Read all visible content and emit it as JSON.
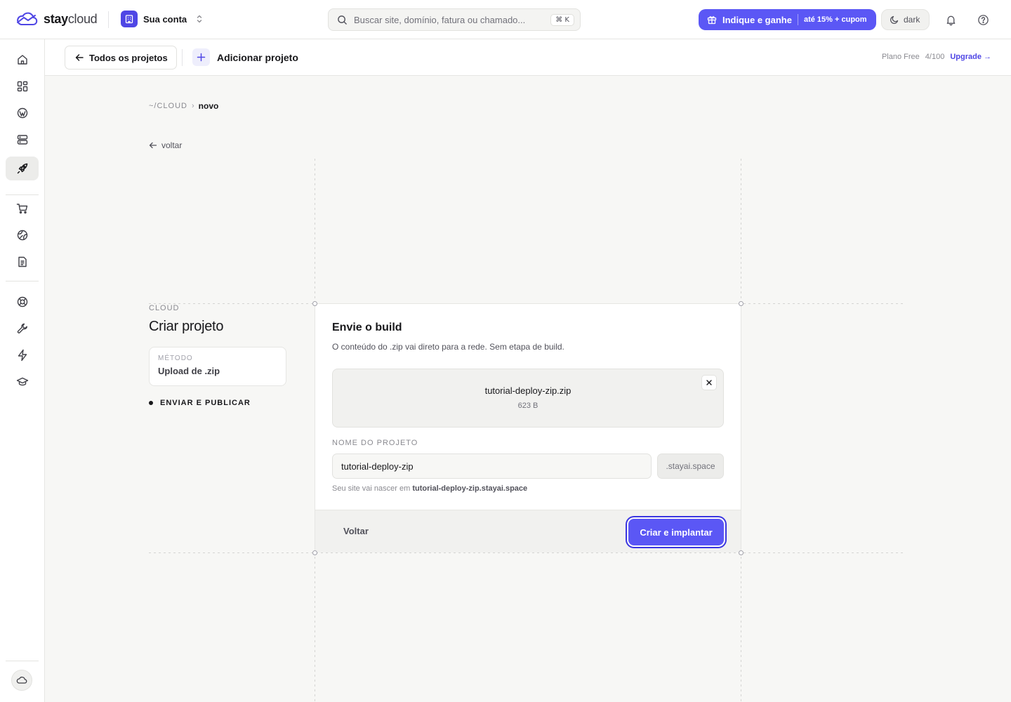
{
  "brand": {
    "name_bold": "stay",
    "name_light": "cloud"
  },
  "account": {
    "name": "Sua conta"
  },
  "search": {
    "placeholder": "Buscar site, domínio, fatura ou chamado...",
    "shortcut": "⌘ K"
  },
  "promo": {
    "label": "Indique e ganhe",
    "badge": "até 15% + cupom"
  },
  "theme": {
    "label": "dark"
  },
  "colors": {
    "accent": "#5b57f5",
    "accent_dark": "#4f46e5",
    "background": "#f7f7f5"
  },
  "icons": {
    "logo": "cloud-icon",
    "account": "building-icon",
    "switch": "chevron-updown-icon",
    "search": "search-icon",
    "promo": "gift-icon",
    "theme": "moon-icon",
    "notifications": "bell-icon",
    "help": "help-circle-icon"
  },
  "sidebar": {
    "items": [
      {
        "icon": "home-icon"
      },
      {
        "icon": "grid-icon"
      },
      {
        "icon": "wordpress-icon"
      },
      {
        "icon": "server-icon"
      },
      {
        "icon": "rocket-icon",
        "active": true
      },
      {
        "icon": "cart-icon"
      },
      {
        "icon": "globe-icon"
      },
      {
        "icon": "document-icon"
      },
      {
        "icon": "lifebuoy-icon"
      },
      {
        "icon": "wrench-icon"
      },
      {
        "icon": "bolt-icon"
      },
      {
        "icon": "graduation-cap-icon"
      }
    ],
    "bottom_icon": "cloud-icon"
  },
  "subheader": {
    "back_all": "Todos os projetos",
    "add_project": "Adicionar projeto",
    "plan_label": "Plano Free",
    "plan_count": "4/100",
    "upgrade": "Upgrade →"
  },
  "breadcrumb": {
    "root": "~/CLOUD",
    "separator": "›",
    "current": "novo"
  },
  "back_link": "voltar",
  "wizard": {
    "kicker": "CLOUD",
    "title": "Criar projeto",
    "method_label": "MÉTODO",
    "method_value": "Upload de .zip",
    "current_step": "ENVIAR E PUBLICAR"
  },
  "upload": {
    "title": "Envie o build",
    "subtitle": "O conteúdo do .zip vai direto para a rede. Sem etapa de build.",
    "file_name": "tutorial-deploy-zip.zip",
    "file_size": "623 B",
    "field_label": "NOME DO PROJETO",
    "project_name": "tutorial-deploy-zip",
    "domain_suffix": ".stayai.space",
    "hint_prefix": "Seu site vai nascer em",
    "hint_domain": "tutorial-deploy-zip.stayai.space",
    "back_button": "Voltar",
    "submit_button": "Criar e implantar"
  }
}
